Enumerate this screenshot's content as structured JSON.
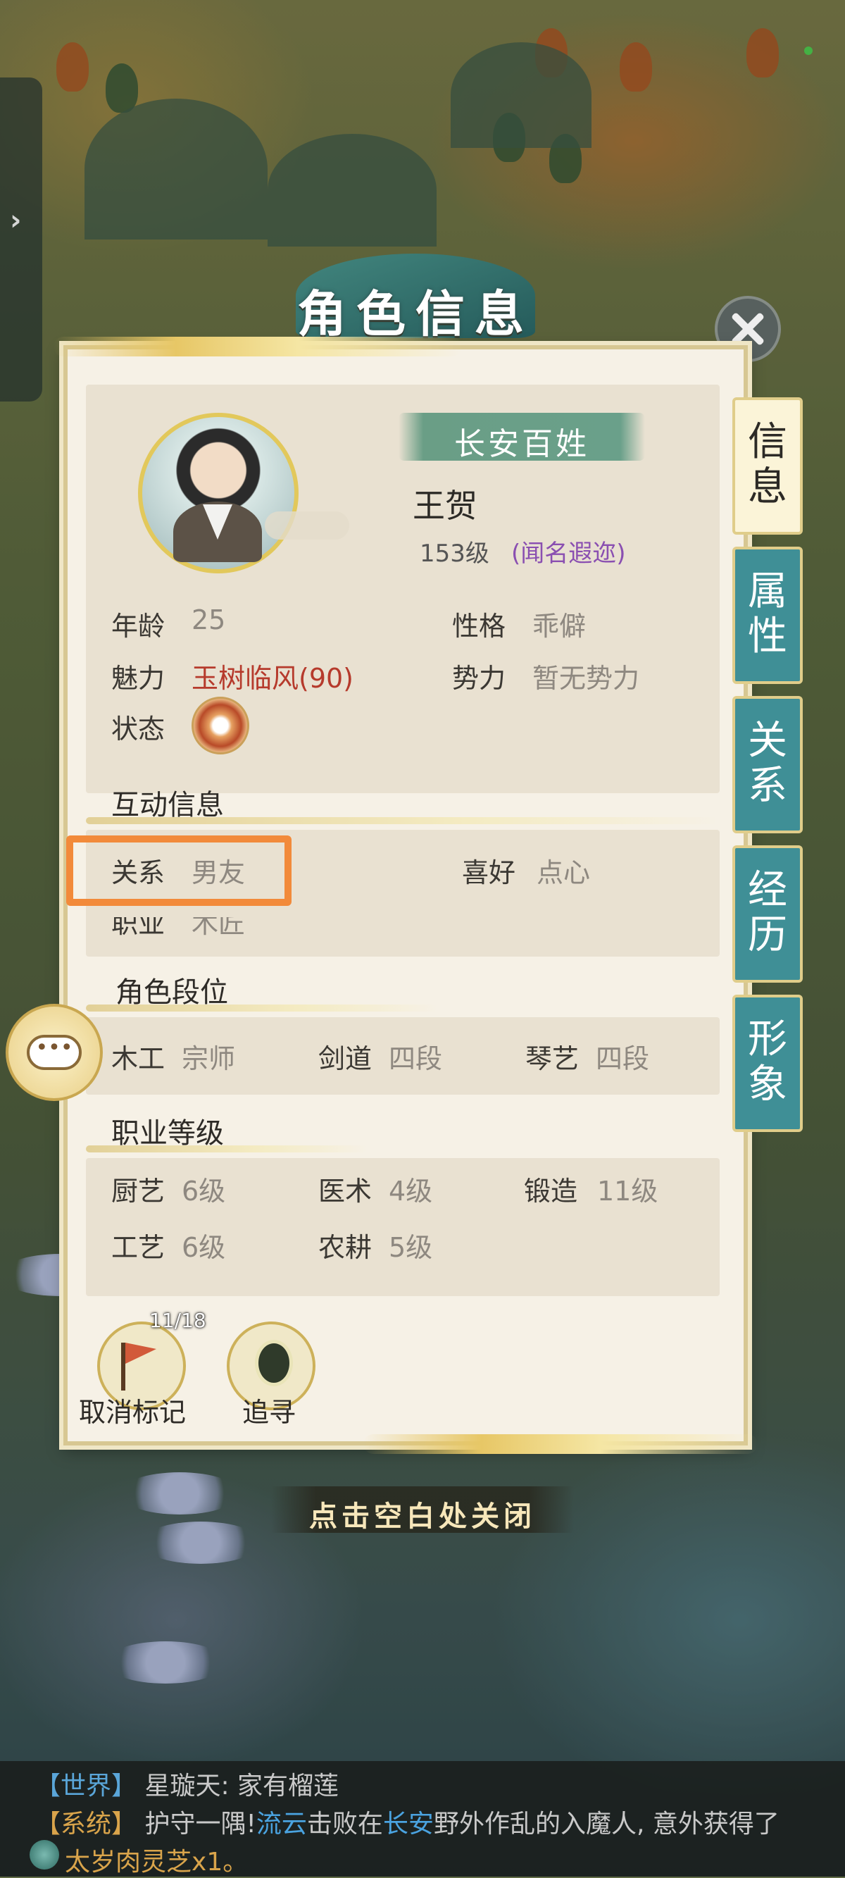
{
  "window": {
    "title": "角色信息",
    "close_hint": "点击空白处关闭"
  },
  "profile": {
    "rank_title": "长安百姓",
    "name": "王贺",
    "level": "153级",
    "fame": "(闻名遐迩)"
  },
  "basic": {
    "age_label": "年龄",
    "age_value": "25",
    "personality_label": "性格",
    "personality_value": "乖僻",
    "charm_label": "魅力",
    "charm_value": "玉树临风(90)",
    "faction_label": "势力",
    "faction_value": "暂无势力",
    "status_label": "状态",
    "status_icon": "bowl-icon"
  },
  "interaction": {
    "heading": "互动信息",
    "relation_label": "关系",
    "relation_value": "男友",
    "hobby_label": "喜好",
    "hobby_value": "点心",
    "job_label": "职业",
    "job_value": "木匠"
  },
  "rank_section": {
    "heading": "角色段位",
    "items": [
      {
        "label": "木工",
        "value": "宗师"
      },
      {
        "label": "剑道",
        "value": "四段"
      },
      {
        "label": "琴艺",
        "value": "四段"
      }
    ]
  },
  "job_levels": {
    "heading": "职业等级",
    "items": [
      {
        "label": "厨艺",
        "value": "6级"
      },
      {
        "label": "医术",
        "value": "4级"
      },
      {
        "label": "锻造",
        "value": "11级"
      },
      {
        "label": "工艺",
        "value": "6级"
      },
      {
        "label": "农耕",
        "value": "5级"
      }
    ]
  },
  "tabs": [
    {
      "label": "信\n息",
      "active": true
    },
    {
      "label": "属\n性",
      "active": false
    },
    {
      "label": "关\n系",
      "active": false
    },
    {
      "label": "经\n历",
      "active": false
    },
    {
      "label": "形\n象",
      "active": false
    }
  ],
  "actions": {
    "unmark_label": "取消标记",
    "unmark_count": "11/18",
    "track_label": "追寻"
  },
  "chat": {
    "line1_tag": "【世界】",
    "line1_text": "星璇天: 家有榴莲",
    "line2_tag": "【系统】",
    "line2_a": "护守一隅!",
    "line2_b": "流云",
    "line2_c": "击败在",
    "line2_d": "长安",
    "line2_e": "野外作乱的入魔人, 意外获得了",
    "line3_item": "太岁肉灵芝",
    "line3_qty": "x1。"
  },
  "colors": {
    "highlight": "#f28a3a",
    "tab_teal": "#3f8f96",
    "fame_purple": "#8a4fb1",
    "charm_red": "#b63a2c"
  }
}
